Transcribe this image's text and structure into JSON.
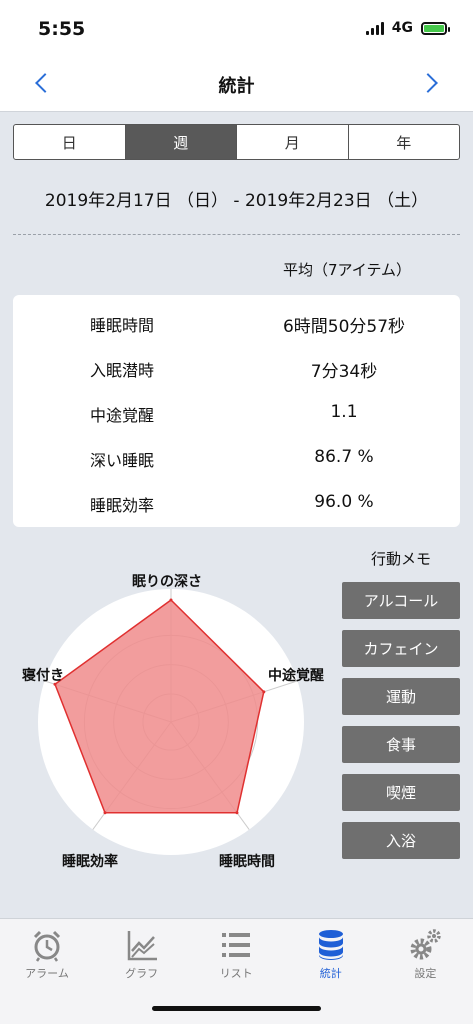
{
  "status": {
    "time": "5:55",
    "network": "4G"
  },
  "nav": {
    "title": "統計"
  },
  "segments": [
    {
      "label": "日",
      "active": false
    },
    {
      "label": "週",
      "active": true
    },
    {
      "label": "月",
      "active": false
    },
    {
      "label": "年",
      "active": false
    }
  ],
  "date_range": "2019年2月17日 （日） - 2019年2月23日 （土）",
  "average_label": "平均（7アイテム）",
  "stats": [
    {
      "label": "睡眠時間",
      "value": "6時間50分57秒"
    },
    {
      "label": "入眠潜時",
      "value": "7分34秒"
    },
    {
      "label": "中途覚醒",
      "value": "1.1"
    },
    {
      "label": "深い睡眠",
      "value": "86.7 %"
    },
    {
      "label": "睡眠効率",
      "value": "96.0 %"
    }
  ],
  "radar": {
    "axes": [
      "眠りの深さ",
      "中途覚醒",
      "睡眠時間",
      "睡眠効率",
      "寝付き"
    ],
    "values": [
      1.0,
      0.8,
      0.92,
      0.92,
      1.0
    ],
    "fill_color": "#f08c8c",
    "stroke_color": "#e03030"
  },
  "memo": {
    "title": "行動メモ",
    "items": [
      "アルコール",
      "カフェイン",
      "運動",
      "食事",
      "喫煙",
      "入浴"
    ]
  },
  "tabs": [
    {
      "label": "アラーム",
      "icon": "alarm-clock-icon",
      "active": false
    },
    {
      "label": "グラフ",
      "icon": "line-graph-icon",
      "active": false
    },
    {
      "label": "リスト",
      "icon": "list-icon",
      "active": false
    },
    {
      "label": "統計",
      "icon": "database-icon",
      "active": true
    },
    {
      "label": "設定",
      "icon": "gears-icon",
      "active": false
    }
  ],
  "colors": {
    "accent": "#1f5fd6",
    "segment_active": "#595959",
    "memo_button": "#6f6f6f"
  }
}
